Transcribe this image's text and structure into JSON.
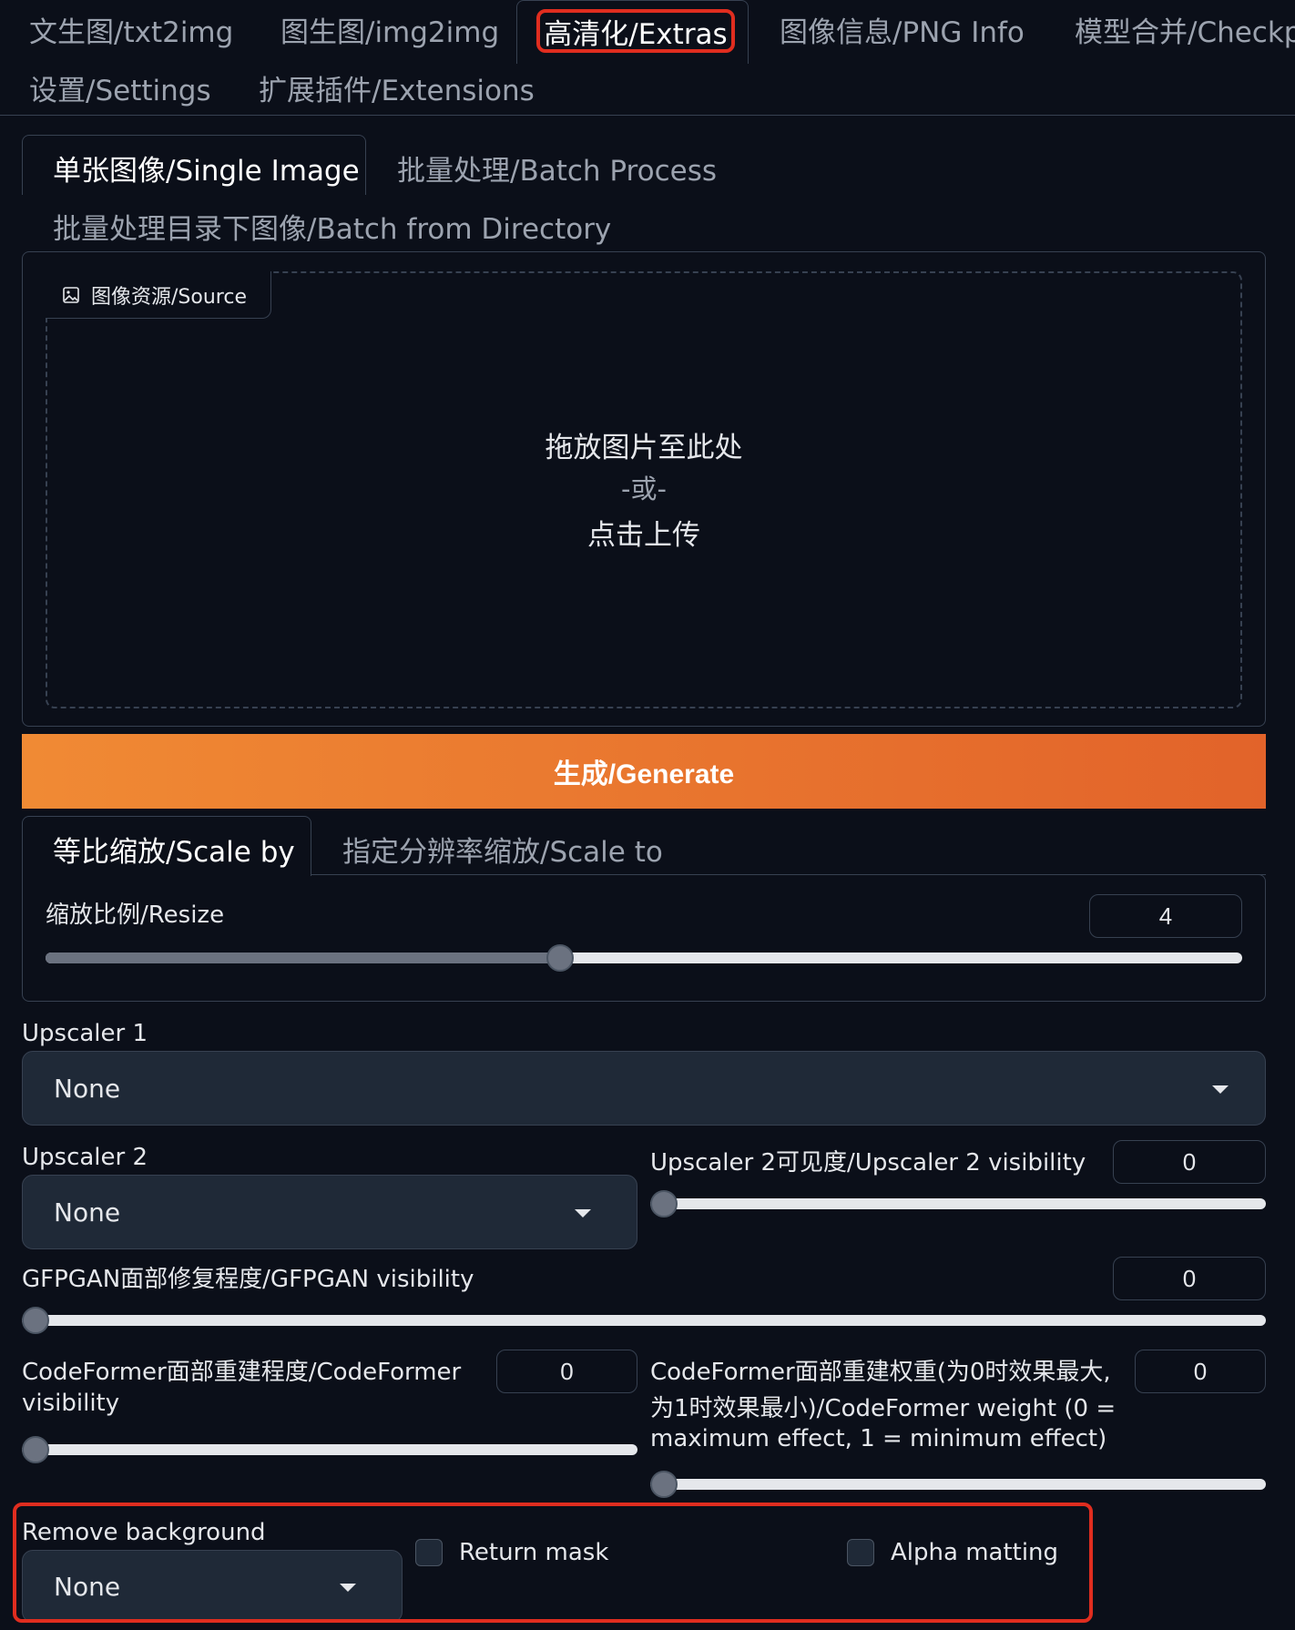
{
  "main_tabs": [
    "文生图/txt2img",
    "图生图/img2img",
    "高清化/Extras",
    "图像信息/PNG Info",
    "模型合并/Checkpoint Merger",
    "设置/Settings",
    "扩展插件/Extensions"
  ],
  "sub_tabs": [
    "单张图像/Single Image",
    "批量处理/Batch Process",
    "批量处理目录下图像/Batch from Directory"
  ],
  "source": {
    "label": "图像资源/Source",
    "drop_line1": "拖放图片至此处",
    "drop_line2": "-或-",
    "drop_line3": "点击上传"
  },
  "generate_label": "生成/Generate",
  "scale_tabs": [
    "等比缩放/Scale by",
    "指定分辨率缩放/Scale to"
  ],
  "resize": {
    "label": "缩放比例/Resize",
    "value": "4",
    "slider_fraction": 0.43
  },
  "upscaler1": {
    "label": "Upscaler 1",
    "value": "None"
  },
  "upscaler2": {
    "label": "Upscaler 2",
    "value": "None"
  },
  "upscaler2_visibility": {
    "label": "Upscaler 2可见度/Upscaler 2 visibility",
    "value": "0"
  },
  "gfpgan_visibility": {
    "label": "GFPGAN面部修复程度/GFPGAN visibility",
    "value": "0"
  },
  "codeformer_visibility": {
    "label_line1": "CodeFormer面部重建程度/CodeFormer",
    "label_line2": "visibility",
    "value": "0"
  },
  "codeformer_weight": {
    "label_line1": "CodeFormer面部重建权重(为0时效果最大,",
    "label_line2": "为1时效果最小)/CodeFormer weight (0 =",
    "label_line3": "maximum effect, 1 = minimum effect)",
    "value": "0"
  },
  "remove_background": {
    "label": "Remove background",
    "value": "None"
  },
  "return_mask": {
    "label": "Return mask",
    "checked": false
  },
  "alpha_matting": {
    "label": "Alpha matting",
    "checked": false
  },
  "colors": {
    "accent_orange": "#e8712e",
    "highlight_red": "#e02d1f",
    "background": "#0b0f19"
  }
}
